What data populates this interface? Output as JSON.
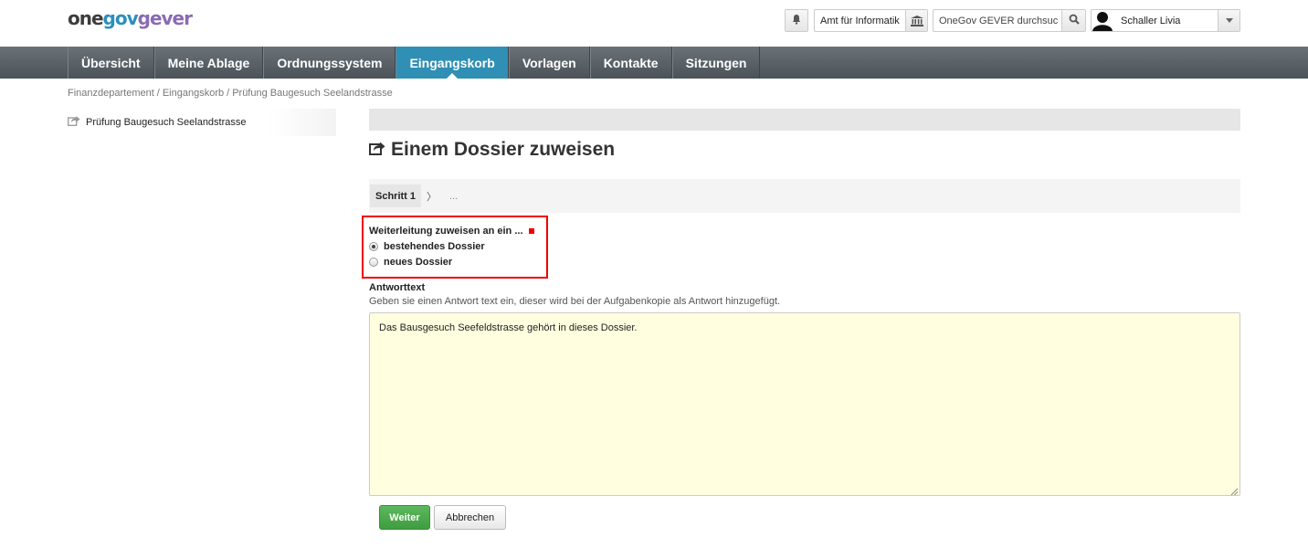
{
  "header": {
    "logo": {
      "one": "one",
      "gov": "gov",
      "gever": "gever"
    },
    "org_unit": "Amt für Informatik",
    "search": {
      "value": "OneGov GEVER durchsuc",
      "placeholder": "OneGov GEVER durchsuchen"
    },
    "user": "Schaller Livia"
  },
  "nav": {
    "items": [
      {
        "label": "Übersicht"
      },
      {
        "label": "Meine Ablage"
      },
      {
        "label": "Ordnungssystem"
      },
      {
        "label": "Eingangskorb"
      },
      {
        "label": "Vorlagen"
      },
      {
        "label": "Kontakte"
      },
      {
        "label": "Sitzungen"
      }
    ],
    "active": "Eingangskorb"
  },
  "breadcrumb": [
    "Finanzdepartement",
    "Eingangskorb",
    "Prüfung Baugesuch Seelandstrasse"
  ],
  "sidebar": {
    "item": "Prüfung Baugesuch Seelandstrasse"
  },
  "main": {
    "title": "Einem Dossier zuweisen",
    "wizard": {
      "step": "Schritt 1",
      "chevron": "〉",
      "more": "..."
    },
    "radio_group": {
      "label": "Weiterleitung zuweisen an ein ...",
      "options": [
        {
          "label": "bestehendes Dossier",
          "checked": true
        },
        {
          "label": "neues Dossier",
          "checked": false
        }
      ]
    },
    "answer": {
      "label": "Antworttext",
      "help": "Geben sie einen Antwort text ein, dieser wird bei der Aufgabenkopie als Antwort hinzugefügt.",
      "value": "Das Bausgesuch Seefeldstrasse gehört in dieses Dossier."
    },
    "buttons": {
      "submit": "Weiter",
      "cancel": "Abbrechen"
    }
  },
  "colors": {
    "nav_active": "#2f8fb4",
    "primary_button": "#4cae4c",
    "required": "#ee0000",
    "textarea_bg": "#ffffdf"
  }
}
